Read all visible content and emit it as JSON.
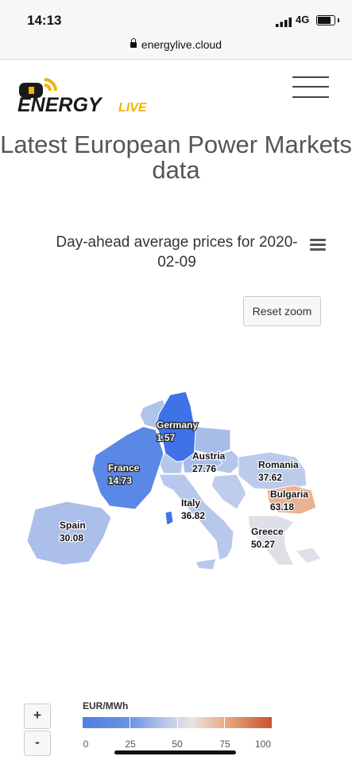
{
  "status_bar": {
    "time": "14:13",
    "network": "4G"
  },
  "browser": {
    "url": "energylive.cloud"
  },
  "header": {
    "logo_text": "ENERGY",
    "logo_suffix": "LIVE",
    "logo_colors": {
      "text": "#1a1a1a",
      "accent": "#f4b400"
    }
  },
  "page": {
    "title": "Latest European Power Markets data"
  },
  "chart": {
    "title": "Day-ahead average prices for 2020-02-09",
    "reset_zoom": "Reset zoom",
    "zoom_in": "+",
    "zoom_out": "-"
  },
  "chart_data": {
    "type": "map",
    "title": "Day-ahead average prices for 2020-02-09",
    "unit": "EUR/MWh",
    "regions": [
      {
        "name": "Germany",
        "value": 1.57,
        "color": "#3f72e8"
      },
      {
        "name": "France",
        "value": 14.73,
        "color": "#5a88e6"
      },
      {
        "name": "Austria",
        "value": 27.76,
        "color": "#a6bbe9"
      },
      {
        "name": "Spain",
        "value": 30.08,
        "color": "#abbfea"
      },
      {
        "name": "Italy",
        "value": 36.82,
        "color": "#b8c8ec"
      },
      {
        "name": "Romania",
        "value": 37.62,
        "color": "#bccbec"
      },
      {
        "name": "Greece",
        "value": 50.27,
        "color": "#e0dfe8"
      },
      {
        "name": "Bulgaria",
        "value": 63.18,
        "color": "#e9b293"
      }
    ],
    "color_axis": {
      "min": 0,
      "max": 100,
      "ticks": [
        "0",
        "25",
        "50",
        "75",
        "100"
      ],
      "colors": [
        "#4f80e3",
        "#bfcbec",
        "#c9522f"
      ]
    }
  }
}
